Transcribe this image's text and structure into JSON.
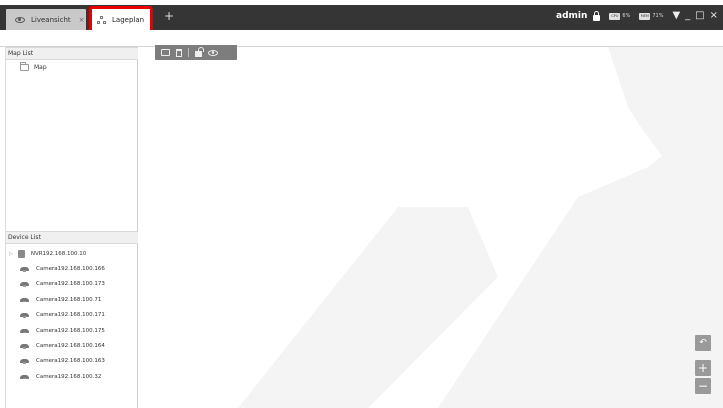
{
  "tabs": {
    "live": {
      "label": "Liveansicht",
      "close": "×"
    },
    "plan": {
      "label": "Lageplan"
    },
    "add": "+"
  },
  "status": {
    "user": "admin",
    "cpu_label": "CPU",
    "cpu_value": "6%",
    "mem_label": "MEM",
    "mem_value": "71%"
  },
  "window_controls": {
    "dropdown": "▼",
    "minimize": "_",
    "maximize": "□",
    "close": "×"
  },
  "map_list": {
    "header": "Map List",
    "items": [
      {
        "label": "Map"
      }
    ]
  },
  "device_list": {
    "header": "Device List",
    "nvr": {
      "label": "NVR192.168.100.10"
    },
    "cameras": [
      {
        "label": "Camera192.168.100.166"
      },
      {
        "label": "Camera192.168.100.173"
      },
      {
        "label": "Camera192.168.100.71"
      },
      {
        "label": "Camera192.168.100.171"
      },
      {
        "label": "Camera192.168.100.175"
      },
      {
        "label": "Camera192.168.100.164"
      },
      {
        "label": "Camera192.168.100.163"
      },
      {
        "label": "Camera192.168.100.32"
      }
    ]
  },
  "map_toolbar": {
    "icons": [
      "folder-icon",
      "trash-icon",
      "unlock-icon",
      "eye-icon"
    ]
  },
  "zoom_controls": {
    "undo": "↶",
    "zoom_in": "+",
    "zoom_out": "−"
  },
  "colors": {
    "titlebar": "#353535",
    "highlight": "#e60000",
    "watermark": "#f3f3f3",
    "toolbar": "#7d7d7d"
  }
}
